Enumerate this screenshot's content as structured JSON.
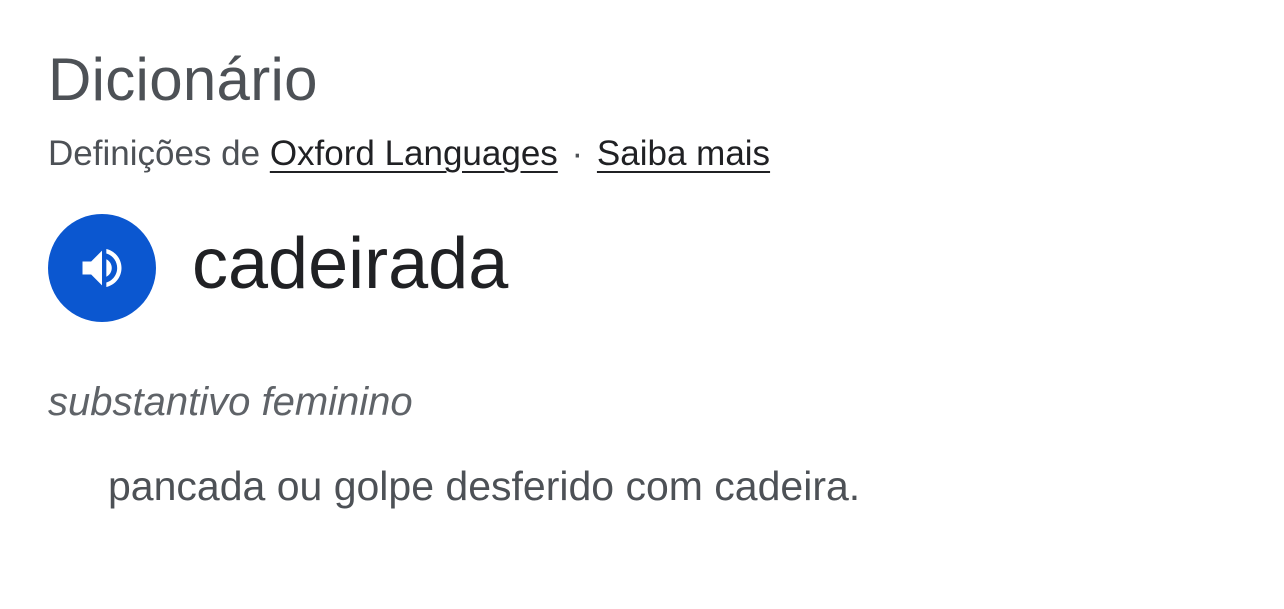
{
  "dictionary": {
    "title": "Dicionário",
    "source": {
      "prefix": "Definições de",
      "provider_link": "Oxford Languages",
      "separator": "·",
      "learn_more_link": "Saiba mais"
    },
    "entry": {
      "audio_icon": "speaker-icon",
      "headword": "cadeirada",
      "part_of_speech": "substantivo feminino",
      "definition": "pancada ou golpe desferido com cadeira."
    }
  },
  "colors": {
    "accent": "#0b57d0",
    "title_text": "#4d5156",
    "headword_text": "#202124",
    "muted_text": "#5f6368",
    "background": "#ffffff"
  }
}
